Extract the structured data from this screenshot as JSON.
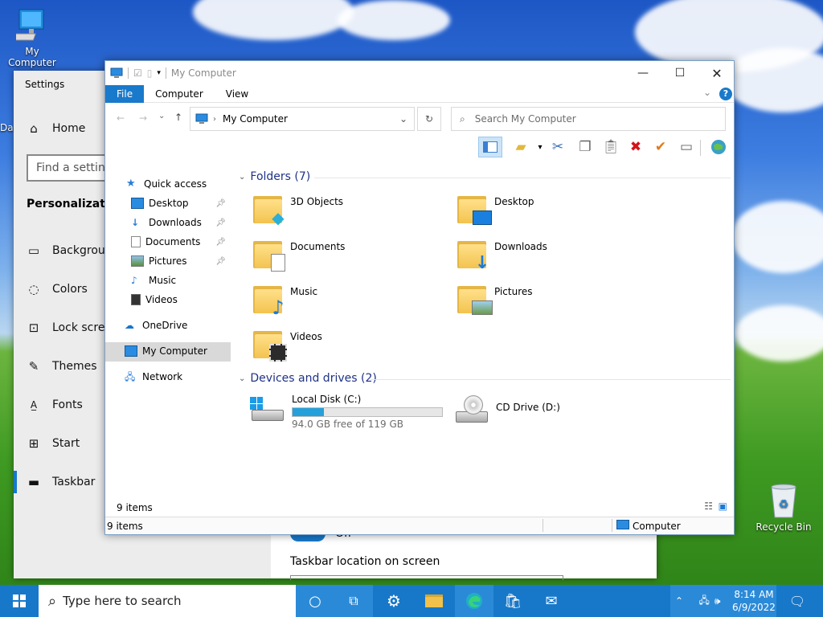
{
  "desktop": {
    "my_computer_label": "My Computer",
    "recycle_bin_label": "Recycle Bin",
    "partial_label": "Da"
  },
  "settings": {
    "title": "Settings",
    "home": "Home",
    "search_placeholder": "Find a setting",
    "section": "Personalization",
    "items": [
      {
        "label": "Background",
        "icon": "image-icon"
      },
      {
        "label": "Colors",
        "icon": "palette-icon"
      },
      {
        "label": "Lock screen",
        "icon": "lock-screen-icon"
      },
      {
        "label": "Themes",
        "icon": "brush-icon"
      },
      {
        "label": "Fonts",
        "icon": "font-icon"
      },
      {
        "label": "Start",
        "icon": "start-icon"
      },
      {
        "label": "Taskbar",
        "icon": "taskbar-icon"
      }
    ],
    "toggle_label": "Off",
    "location_label": "Taskbar location on screen"
  },
  "explorer": {
    "title": "My Computer",
    "tabs": [
      "File",
      "Computer",
      "View"
    ],
    "address": "My Computer",
    "search_placeholder": "Search My Computer",
    "nav": {
      "quick_access": "Quick access",
      "pinned": [
        "Desktop",
        "Downloads",
        "Documents",
        "Pictures"
      ],
      "unpinned": [
        "Music",
        "Videos"
      ],
      "onedrive": "OneDrive",
      "my_computer": "My Computer",
      "network": "Network"
    },
    "folders_header": "Folders (7)",
    "folders": [
      {
        "name": "3D Objects",
        "icon": "3d-objects-icon"
      },
      {
        "name": "Desktop",
        "icon": "desktop-icon"
      },
      {
        "name": "Documents",
        "icon": "documents-icon"
      },
      {
        "name": "Downloads",
        "icon": "downloads-icon"
      },
      {
        "name": "Music",
        "icon": "music-icon"
      },
      {
        "name": "Pictures",
        "icon": "pictures-icon"
      },
      {
        "name": "Videos",
        "icon": "videos-icon"
      }
    ],
    "devices_header": "Devices and drives (2)",
    "drives": [
      {
        "name": "Local Disk (C:)",
        "free": "94.0 GB free of 119 GB",
        "used_fraction": 0.21
      },
      {
        "name": "CD Drive (D:)"
      }
    ],
    "status_items": "9 items",
    "statusbar_items": "9 items",
    "statusbar_location": "Computer"
  },
  "taskbar": {
    "search_placeholder": "Type here to search",
    "time": "8:14 AM",
    "date": "6/9/2022",
    "color": "#1778c9"
  }
}
